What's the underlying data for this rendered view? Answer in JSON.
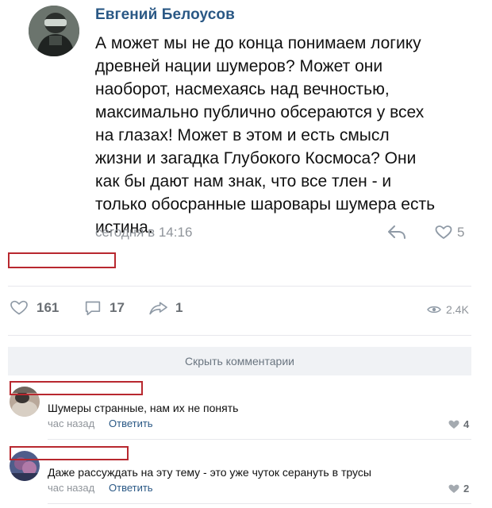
{
  "post_comment": {
    "author": "Евгений Белоусов",
    "text": "А может мы не до конца понимаем логику\nдревней нации шумеров? Может они\nнаоборот, насмехаясь над вечностью,\nмаксимально публично обсераются у всех\nна глазах! Может в этом и есть смысл\nжизни и загадка Глубокого Космоса? Они\nкак бы дают нам знак, что все тлен - и\nтолько обосранные шаровары шумера есть\nистина.",
    "timestamp": "сегодня в 14:16",
    "likes": "5",
    "icons": {
      "reply": "reply-arrow-icon",
      "like": "heart-icon"
    }
  },
  "actions": {
    "likes": "161",
    "comments": "17",
    "shares": "1",
    "views": "2.4K"
  },
  "hide_comments_label": "Скрыть комментарии",
  "comments": [
    {
      "text": "Шумеры странные, нам их не понять",
      "time": "час назад",
      "reply": "Ответить",
      "likes": "4"
    },
    {
      "text": "Даже рассуждать на эту тему - это уже чуток серануть в трусы",
      "time": "час назад",
      "reply": "Ответить",
      "likes": "2"
    }
  ],
  "colors": {
    "link": "#2a5885",
    "muted": "#8f949a",
    "redaction": "#b8282f",
    "button_bg": "#f0f2f5"
  }
}
